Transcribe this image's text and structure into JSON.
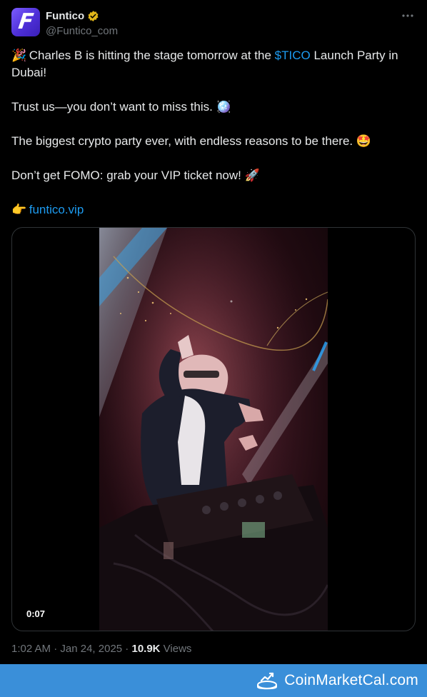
{
  "author": {
    "display_name": "Funtico",
    "handle": "@Funtico_com",
    "avatar_letter": "F"
  },
  "tweet": {
    "line1_emoji": "🎉",
    "line1_pre": " Charles B is hitting the stage tomorrow at the ",
    "cashtag": "$TICO",
    "line1_post": " Launch Party in Dubai!",
    "line2": "Trust us—you don’t want to miss this. ",
    "line2_emoji": "🪩",
    "line3": "The biggest crypto party ever, with endless reasons to be there. ",
    "line3_emoji": "🤩",
    "line4": "Don’t get FOMO: grab your VIP ticket now! ",
    "line4_emoji": "🚀",
    "link_emoji": "👉",
    "link_text": "funtico.vip"
  },
  "media": {
    "duration": "0:07"
  },
  "meta": {
    "time": "1:02 AM",
    "separator": " · ",
    "date": "Jan 24, 2025",
    "views_count": "10.9K",
    "views_label": " Views"
  },
  "banner": {
    "brand_text": "CoinMarketCal.com"
  },
  "colors": {
    "link": "#1d9bf0",
    "banner": "#3a8fd9",
    "verified": "#e2b719"
  }
}
